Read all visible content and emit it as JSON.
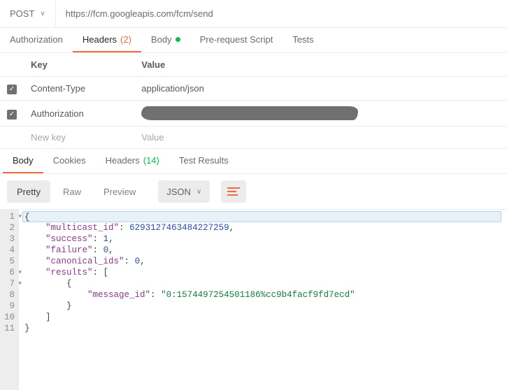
{
  "request": {
    "method": "POST",
    "url": "https://fcm.googleapis.com/fcm/send"
  },
  "request_tabs": {
    "auth": "Authorization",
    "headers": "Headers",
    "headers_count": "(2)",
    "body": "Body",
    "prereq": "Pre-request Script",
    "tests": "Tests"
  },
  "headers_table": {
    "col_key": "Key",
    "col_value": "Value",
    "rows": [
      {
        "key": "Content-Type",
        "value": "application/json"
      },
      {
        "key": "Authorization",
        "value": ""
      }
    ],
    "placeholder_key": "New key",
    "placeholder_value": "Value"
  },
  "response_tabs": {
    "body": "Body",
    "cookies": "Cookies",
    "headers": "Headers",
    "headers_count": "(14)",
    "tests": "Test Results"
  },
  "body_view": {
    "pretty": "Pretty",
    "raw": "Raw",
    "preview": "Preview",
    "format": "JSON"
  },
  "code": {
    "l1": "{",
    "l2a": "    \"multicast_id\"",
    "l2b": ": ",
    "l2c": "6293127463484227259",
    "l2d": ",",
    "l3a": "    \"success\"",
    "l3b": ": ",
    "l3c": "1",
    "l3d": ",",
    "l4a": "    \"failure\"",
    "l4b": ": ",
    "l4c": "0",
    "l4d": ",",
    "l5a": "    \"canonical_ids\"",
    "l5b": ": ",
    "l5c": "0",
    "l5d": ",",
    "l6a": "    \"results\"",
    "l6b": ": [",
    "l7": "        {",
    "l8a": "            \"message_id\"",
    "l8b": ": ",
    "l8c": "\"0:1574497254501186%cc9b4facf9fd7ecd\"",
    "l9": "        }",
    "l10": "    ]",
    "l11": "}"
  },
  "line_numbers": [
    "1",
    "2",
    "3",
    "4",
    "5",
    "6",
    "7",
    "8",
    "9",
    "10",
    "11"
  ]
}
